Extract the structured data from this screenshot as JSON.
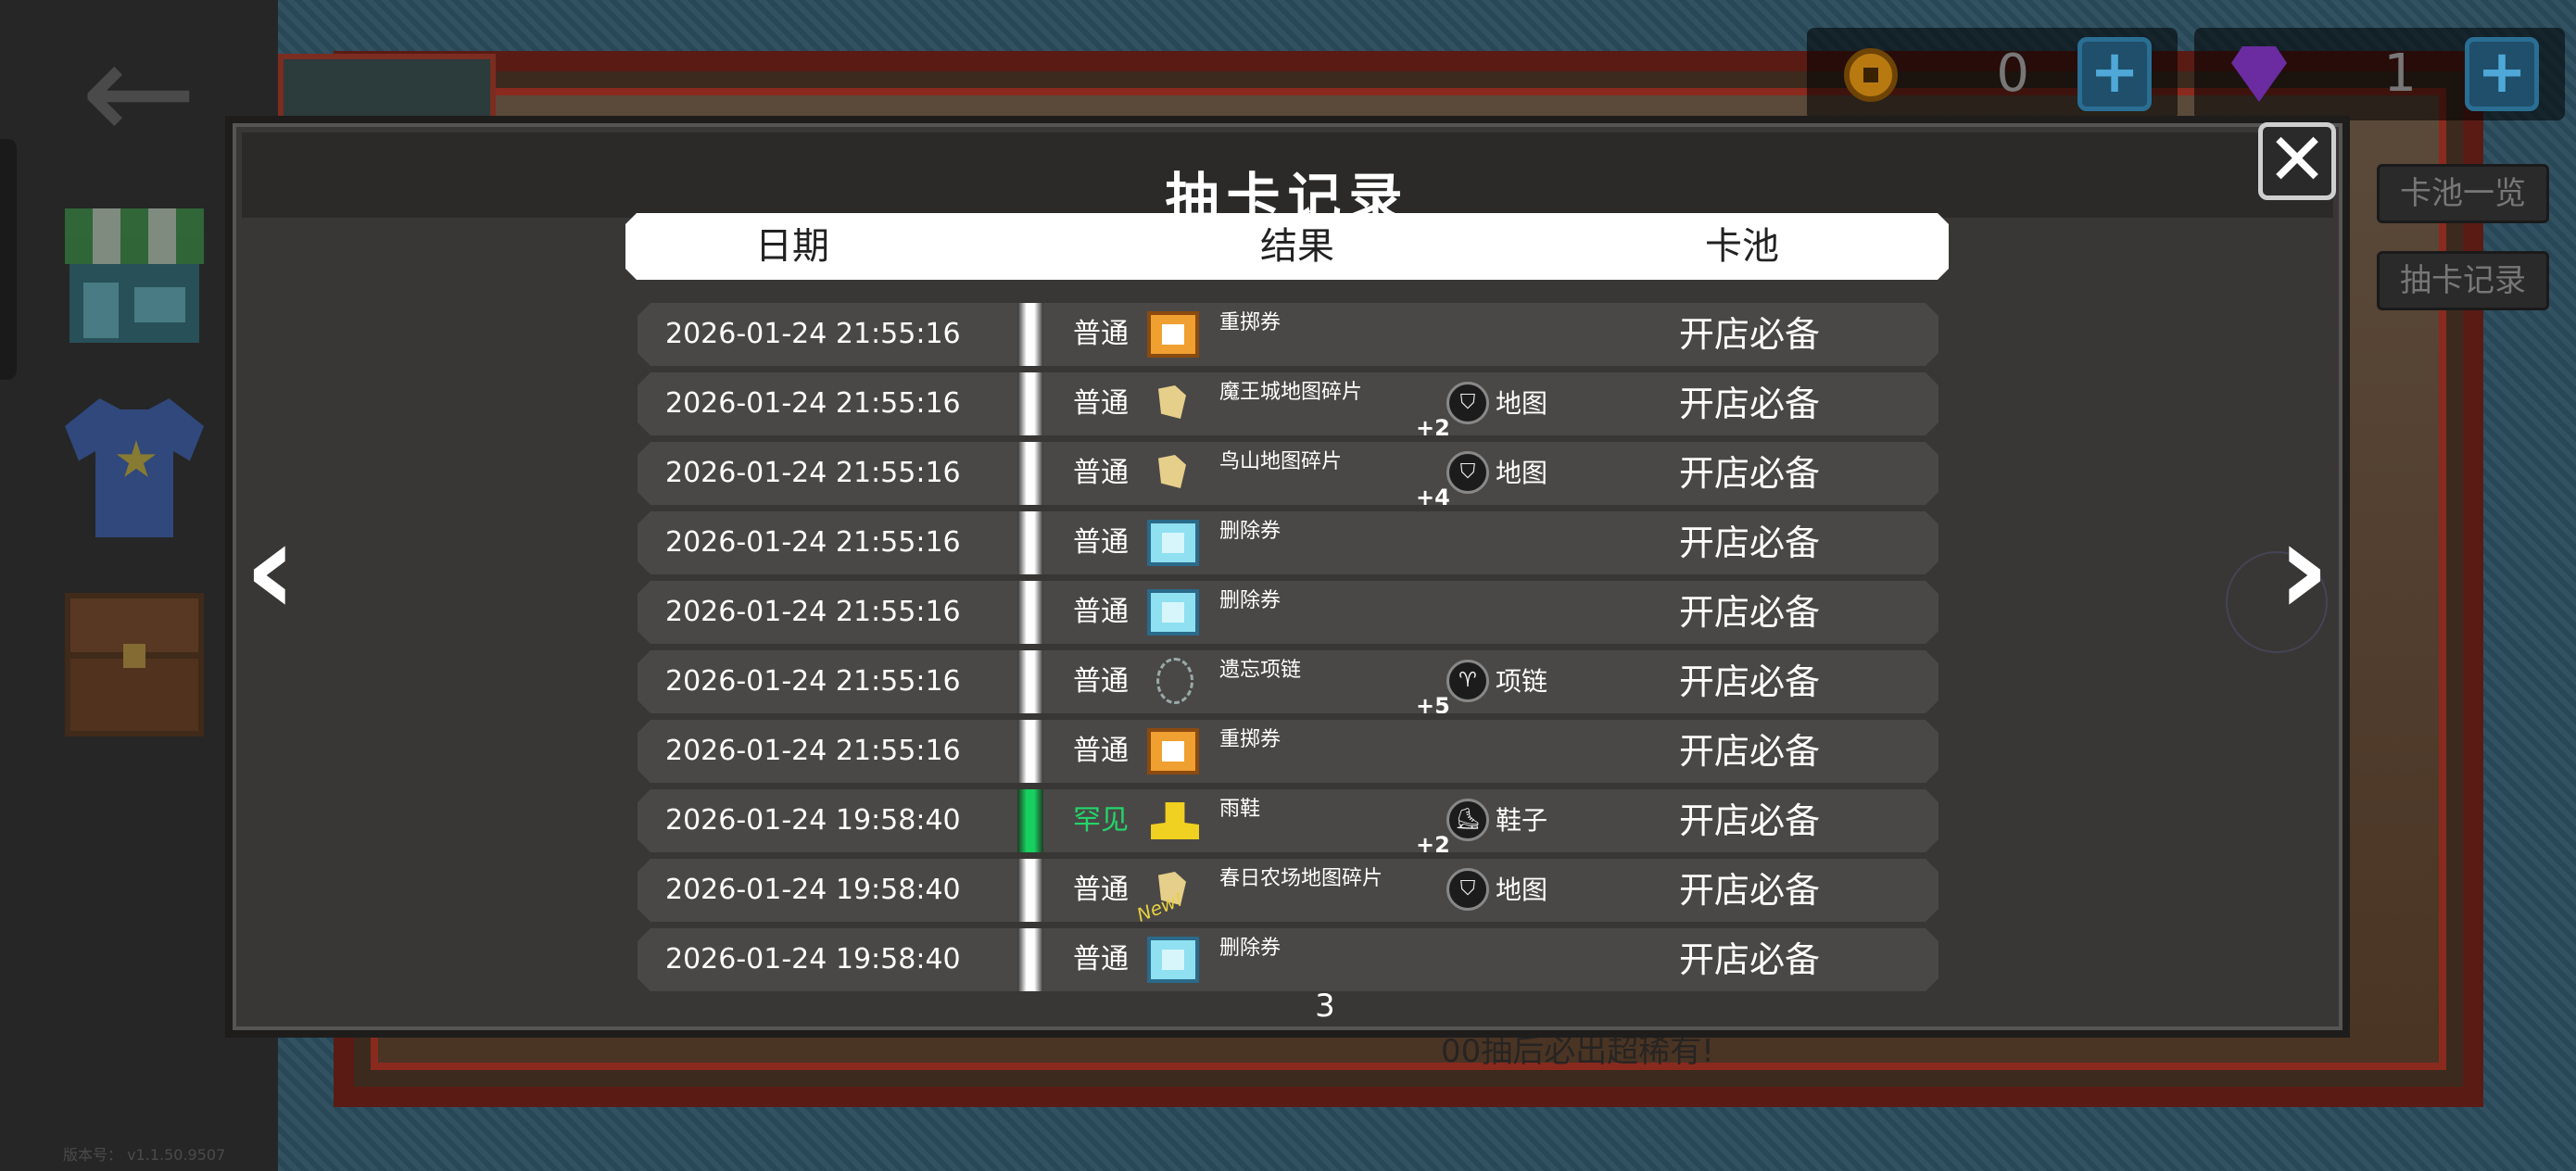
{
  "currency": {
    "coins": "0",
    "gems": "1",
    "coin_icon": "gold-coin-icon",
    "gem_icon": "purple-gem-icon",
    "add_label": "+"
  },
  "background": {
    "tab_pool_list": "卡池一览",
    "tab_draw_history": "抽卡记录",
    "obscured_text": "00抽后必出超稀有!",
    "version": "版本号： v1.1.50.9507"
  },
  "sidebar": {
    "back_icon": "back-arrow-icon",
    "items": [
      "shop-icon",
      "shirt-icon",
      "chest-icon"
    ]
  },
  "dialog": {
    "title": "抽卡记录",
    "close_label": "✕",
    "columns": {
      "date": "日期",
      "result": "结果",
      "pool": "卡池"
    },
    "page": "3",
    "prev_label": "‹",
    "next_label": "›"
  },
  "rows": [
    {
      "date": "2026-01-24 21:55:16",
      "rarity": "普通",
      "rare": false,
      "icon": "orange-ticket-icon",
      "item": "重掷券",
      "category": "",
      "plus": "",
      "is_new": false,
      "pool": "开店必备"
    },
    {
      "date": "2026-01-24 21:55:16",
      "rarity": "普通",
      "rare": false,
      "icon": "map-fragment-icon",
      "item": "魔王城地图碎片",
      "category": "地图",
      "plus": "+2",
      "is_new": false,
      "pool": "开店必备"
    },
    {
      "date": "2026-01-24 21:55:16",
      "rarity": "普通",
      "rare": false,
      "icon": "map-fragment-icon",
      "item": "鸟山地图碎片",
      "category": "地图",
      "plus": "+4",
      "is_new": false,
      "pool": "开店必备"
    },
    {
      "date": "2026-01-24 21:55:16",
      "rarity": "普通",
      "rare": false,
      "icon": "blue-ticket-icon",
      "item": "删除券",
      "category": "",
      "plus": "",
      "is_new": false,
      "pool": "开店必备"
    },
    {
      "date": "2026-01-24 21:55:16",
      "rarity": "普通",
      "rare": false,
      "icon": "blue-ticket-icon",
      "item": "删除券",
      "category": "",
      "plus": "",
      "is_new": false,
      "pool": "开店必备"
    },
    {
      "date": "2026-01-24 21:55:16",
      "rarity": "普通",
      "rare": false,
      "icon": "necklace-icon",
      "item": "遗忘项链",
      "category": "项链",
      "plus": "+5",
      "is_new": false,
      "pool": "开店必备"
    },
    {
      "date": "2026-01-24 21:55:16",
      "rarity": "普通",
      "rare": false,
      "icon": "orange-ticket-icon",
      "item": "重掷券",
      "category": "",
      "plus": "",
      "is_new": false,
      "pool": "开店必备"
    },
    {
      "date": "2026-01-24 19:58:40",
      "rarity": "罕见",
      "rare": true,
      "icon": "boot-icon",
      "item": "雨鞋",
      "category": "鞋子",
      "plus": "+2",
      "is_new": false,
      "pool": "开店必备"
    },
    {
      "date": "2026-01-24 19:58:40",
      "rarity": "普通",
      "rare": false,
      "icon": "map-fragment-icon",
      "item": "春日农场地图碎片",
      "category": "地图",
      "plus": "",
      "is_new": true,
      "new_label": "New!",
      "pool": "开店必备"
    },
    {
      "date": "2026-01-24 19:58:40",
      "rarity": "普通",
      "rare": false,
      "icon": "blue-ticket-icon",
      "item": "删除券",
      "category": "",
      "plus": "",
      "is_new": false,
      "pool": "开店必备"
    }
  ]
}
